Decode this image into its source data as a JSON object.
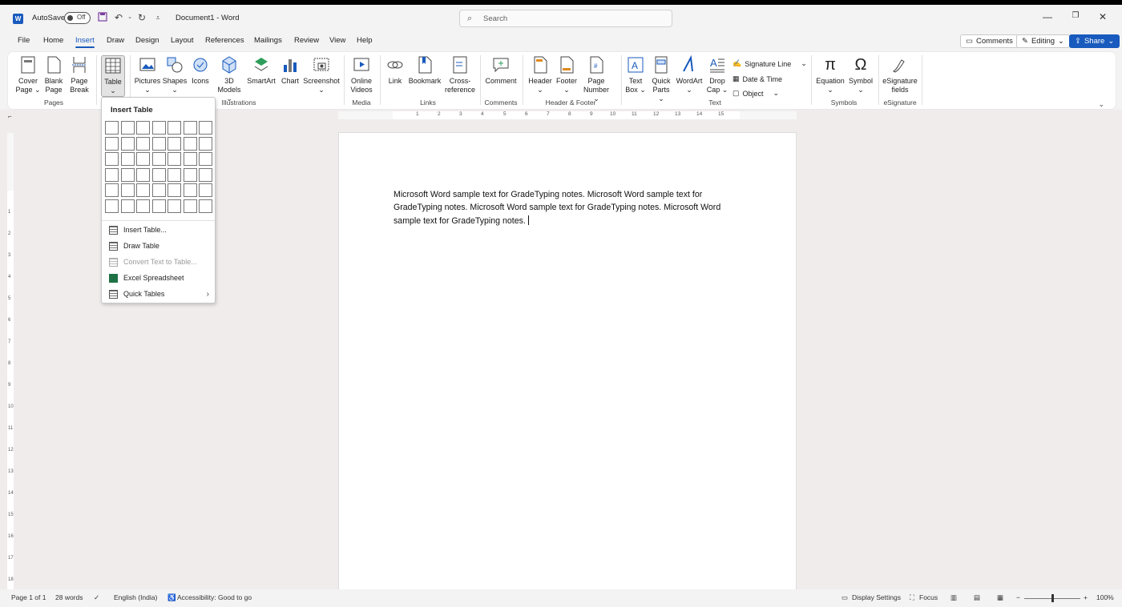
{
  "titlebar": {
    "autosave_label": "AutoSave",
    "autosave_state": "Off",
    "doc_title": "Document1  -  Word",
    "search_placeholder": "Search"
  },
  "tabs": [
    "File",
    "Home",
    "Insert",
    "Draw",
    "Design",
    "Layout",
    "References",
    "Mailings",
    "Review",
    "View",
    "Help"
  ],
  "active_tab": "Insert",
  "topbar": {
    "comments": "Comments",
    "editing": "Editing",
    "share": "Share"
  },
  "ribbon": {
    "pages": {
      "cover_page": [
        "Cover",
        "Page"
      ],
      "blank_page": [
        "Blank",
        "Page"
      ],
      "page_break": [
        "Page",
        "Break"
      ],
      "label": "Pages"
    },
    "tables": {
      "table": "Table"
    },
    "illustrations": {
      "pictures": "Pictures",
      "shapes": "Shapes",
      "icons": "Icons",
      "models": [
        "3D",
        "Models"
      ],
      "smartart": "SmartArt",
      "chart": "Chart",
      "screenshot": "Screenshot",
      "label": "Illustrations"
    },
    "media": {
      "online_videos": [
        "Online",
        "Videos"
      ],
      "label": "Media"
    },
    "links": {
      "link": "Link",
      "bookmark": "Bookmark",
      "cross_ref": [
        "Cross-",
        "reference"
      ],
      "label": "Links"
    },
    "comments": {
      "comment": "Comment",
      "label": "Comments"
    },
    "header_footer": {
      "header": "Header",
      "footer": "Footer",
      "page_number": [
        "Page",
        "Number"
      ],
      "label": "Header & Footer"
    },
    "text": {
      "text_box": [
        "Text",
        "Box"
      ],
      "quick_parts": [
        "Quick",
        "Parts"
      ],
      "wordart": "WordArt",
      "drop_cap": [
        "Drop",
        "Cap"
      ],
      "signature_line": "Signature Line",
      "date_time": "Date & Time",
      "object": "Object",
      "label": "Text"
    },
    "symbols": {
      "equation": "Equation",
      "symbol": "Symbol",
      "label": "Symbols"
    },
    "esignature": {
      "fields": [
        "eSignature",
        "fields"
      ],
      "label": "eSignature"
    }
  },
  "dropdown": {
    "title": "Insert Table",
    "grid_cols": 7,
    "grid_rows": 6,
    "items": [
      {
        "label": "Insert Table...",
        "disabled": false
      },
      {
        "label": "Draw Table",
        "disabled": false
      },
      {
        "label": "Convert Text to Table...",
        "disabled": true
      },
      {
        "label": "Excel Spreadsheet",
        "disabled": false
      },
      {
        "label": "Quick Tables",
        "disabled": false
      }
    ]
  },
  "document": {
    "text": "Microsoft Word sample text for GradeTyping notes. Microsoft Word sample text for GradeTyping notes. Microsoft Word sample text for GradeTyping notes. Microsoft Word sample text for GradeTyping notes."
  },
  "ruler": {
    "h_ticks": [
      "1",
      "2",
      "3",
      "4",
      "5",
      "6",
      "7",
      "8",
      "9",
      "10",
      "11",
      "12",
      "13",
      "14",
      "15"
    ],
    "v_ticks": [
      "1",
      "2",
      "3",
      "4",
      "5",
      "6",
      "7",
      "8",
      "9",
      "10",
      "11",
      "12",
      "13",
      "14",
      "15",
      "16",
      "17",
      "18"
    ]
  },
  "status": {
    "page": "Page 1 of 1",
    "words": "28 words",
    "language": "English (India)",
    "accessibility": "Accessibility: Good to go",
    "display_settings": "Display Settings",
    "focus": "Focus",
    "zoom": "100%"
  },
  "colors": {
    "accent": "#185abd",
    "excel": "#1e7145"
  }
}
